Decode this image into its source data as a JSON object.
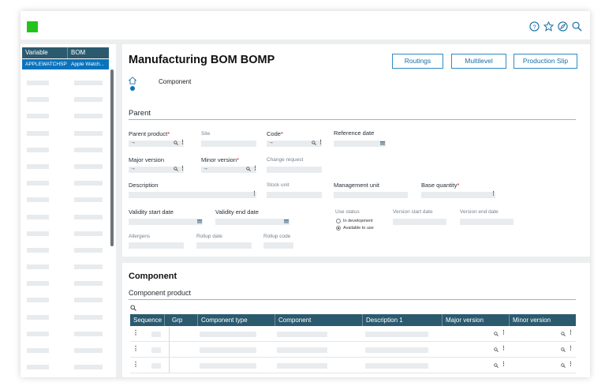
{
  "sidebar": {
    "columns": [
      "Variable",
      "BOM"
    ],
    "selected_row": [
      "APPLEWATCHSP",
      "Apple Watch..."
    ]
  },
  "header": {
    "title": "Manufacturing BOM BOMP",
    "buttons": [
      "Routings",
      "Multilevel",
      "Production Slip"
    ]
  },
  "nav": {
    "tab": "Component"
  },
  "parent": {
    "section_title": "Parent",
    "parent_product": "Parent product",
    "site": "Site",
    "code": "Code",
    "reference_date": "Reference date",
    "major_version": "Major version",
    "minor_version": "Minor version",
    "change_request": "Change request",
    "description": "Description",
    "stock_unit": "Stock unit",
    "management_unit": "Management unit",
    "base_quantity": "Base quantity",
    "validity_start": "Validity start date",
    "validity_end": "Validity end date",
    "use_status": "Use status",
    "in_development": "In development",
    "available_to_use": "Available to use",
    "version_start": "Version start date",
    "version_end": "Version end date",
    "allergens": "Allergens",
    "rollup_date": "Rollup date",
    "rollup_code": "Rollup code",
    "required_mark": "*",
    "arrow": "→"
  },
  "component": {
    "section_title": "Component",
    "subsection": "Component product",
    "columns": [
      "Sequence",
      "Grp",
      "Component type",
      "Component",
      "Description 1",
      "Major version",
      "Minor version"
    ]
  },
  "colors": {
    "accent": "#0a73bd",
    "header_bg": "#2b5a6f",
    "logo": "#22c41a"
  },
  "icons": [
    "help-icon",
    "star-icon",
    "compass-icon",
    "search-icon",
    "home-icon",
    "calendar-icon",
    "more-icon"
  ]
}
